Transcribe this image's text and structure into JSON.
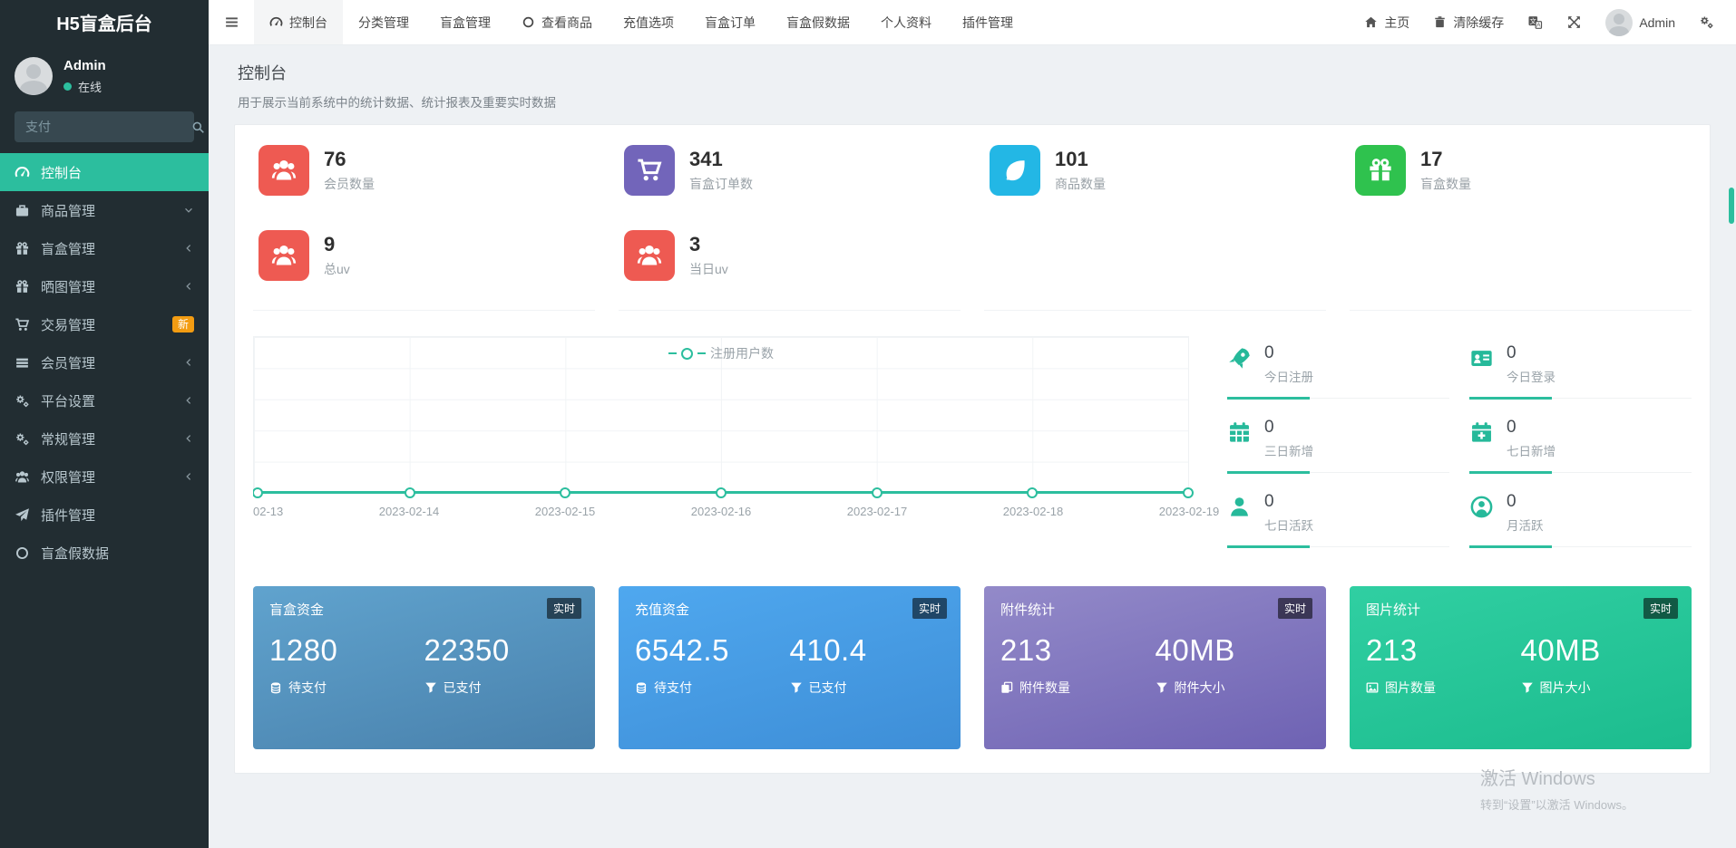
{
  "app": {
    "title": "H5盲盒后台"
  },
  "topnav": {
    "tabs": [
      {
        "label": "控制台",
        "icon": "tachometer-icon",
        "active": true
      },
      {
        "label": "分类管理"
      },
      {
        "label": "盲盒管理"
      },
      {
        "label": "查看商品",
        "icon": "circle-o-icon"
      },
      {
        "label": "充值选项"
      },
      {
        "label": "盲盒订单"
      },
      {
        "label": "盲盒假数据"
      },
      {
        "label": "个人资料"
      },
      {
        "label": "插件管理"
      }
    ],
    "right": {
      "home_label": "主页",
      "clear_cache_label": "清除缓存",
      "user_name": "Admin",
      "icons": [
        "translate-icon",
        "fullscreen-icon",
        "gear-icon"
      ]
    }
  },
  "sidebar": {
    "user": {
      "name": "Admin",
      "status": "在线"
    },
    "search_placeholder": "支付",
    "items": [
      {
        "label": "控制台",
        "icon": "tachometer-icon",
        "active": true
      },
      {
        "label": "商品管理",
        "icon": "briefcase-icon",
        "arrow": "down"
      },
      {
        "label": "盲盒管理",
        "icon": "gift-icon",
        "arrow": "left"
      },
      {
        "label": "晒图管理",
        "icon": "gift-icon",
        "arrow": "left"
      },
      {
        "label": "交易管理",
        "icon": "cart-icon",
        "badge": "新"
      },
      {
        "label": "会员管理",
        "icon": "list-icon",
        "arrow": "left"
      },
      {
        "label": "平台设置",
        "icon": "cogs-icon",
        "arrow": "left"
      },
      {
        "label": "常规管理",
        "icon": "cogs-icon",
        "arrow": "left"
      },
      {
        "label": "权限管理",
        "icon": "users-icon",
        "arrow": "left"
      },
      {
        "label": "插件管理",
        "icon": "send-icon"
      },
      {
        "label": "盲盒假数据",
        "icon": "circle-o-icon"
      }
    ]
  },
  "page_header": {
    "title": "控制台",
    "subtitle": "用于展示当前系统中的统计数据、统计报表及重要实时数据"
  },
  "stat_cards": [
    {
      "value": "76",
      "label": "会员数量",
      "icon": "users-icon",
      "color": "#ee5a52"
    },
    {
      "value": "341",
      "label": "盲盒订单数",
      "icon": "cart-icon",
      "color": "#7265ba"
    },
    {
      "value": "101",
      "label": "商品数量",
      "icon": "leaf-icon",
      "color": "#23b7e5"
    },
    {
      "value": "17",
      "label": "盲盒数量",
      "icon": "gift-icon",
      "color": "#2fc24e"
    },
    {
      "value": "9",
      "label": "总uv",
      "icon": "users-icon",
      "color": "#ee5a52"
    },
    {
      "value": "3",
      "label": "当日uv",
      "icon": "users-icon",
      "color": "#ee5a52"
    }
  ],
  "chart_data": {
    "type": "line",
    "x": [
      "2023-02-13",
      "2023-02-14",
      "2023-02-15",
      "2023-02-16",
      "2023-02-17",
      "2023-02-18",
      "2023-02-19"
    ],
    "tick_labels": [
      "02-13",
      "2023-02-14",
      "2023-02-15",
      "2023-02-16",
      "2023-02-17",
      "2023-02-18",
      "2023-02-19"
    ],
    "series": [
      {
        "name": "注册用户数",
        "values": [
          0,
          0,
          0,
          0,
          0,
          0,
          0
        ]
      }
    ],
    "line_color": "#2cbe9e",
    "marker": "hollow-circle",
    "grid": true,
    "legend_position": "top-center"
  },
  "mini_stats": [
    {
      "value": "0",
      "label": "今日注册",
      "icon": "rocket-icon"
    },
    {
      "value": "0",
      "label": "今日登录",
      "icon": "id-card-icon"
    },
    {
      "value": "0",
      "label": "三日新增",
      "icon": "calendar-icon"
    },
    {
      "value": "0",
      "label": "七日新增",
      "icon": "calendar-plus-icon"
    },
    {
      "value": "0",
      "label": "七日活跃",
      "icon": "user-icon"
    },
    {
      "value": "0",
      "label": "月活跃",
      "icon": "user-circle-icon"
    }
  ],
  "summary_cards": [
    {
      "title": "盲盒资金",
      "badge": "实时",
      "left": {
        "value": "1280",
        "label": "待支付",
        "icon": "database-icon"
      },
      "right": {
        "value": "22350",
        "label": "已支付",
        "icon": "filter-icon"
      },
      "gradient": [
        "#60a3ce",
        "#4981ac"
      ]
    },
    {
      "title": "充值资金",
      "badge": "实时",
      "left": {
        "value": "6542.5",
        "label": "待支付",
        "icon": "database-icon"
      },
      "right": {
        "value": "410.4",
        "label": "已支付",
        "icon": "filter-icon"
      },
      "gradient": [
        "#4fa8ef",
        "#3e8ed7"
      ]
    },
    {
      "title": "附件统计",
      "badge": "实时",
      "left": {
        "value": "213",
        "label": "附件数量",
        "icon": "copy-icon"
      },
      "right": {
        "value": "40MB",
        "label": "附件大小",
        "icon": "filter-icon"
      },
      "gradient": [
        "#938ac9",
        "#6e62b3"
      ]
    },
    {
      "title": "图片统计",
      "badge": "实时",
      "left": {
        "value": "213",
        "label": "图片数量",
        "icon": "image-icon"
      },
      "right": {
        "value": "40MB",
        "label": "图片大小",
        "icon": "filter-icon"
      },
      "gradient": [
        "#30cfa2",
        "#1cbc8e"
      ]
    }
  ],
  "watermark": {
    "line1": "激活 Windows",
    "line2": "转到“设置”以激活 Windows。"
  },
  "colors": {
    "sidebar_bg": "#222d32",
    "accent_teal": "#2cbe9e",
    "badge_orange": "#f39c12"
  }
}
